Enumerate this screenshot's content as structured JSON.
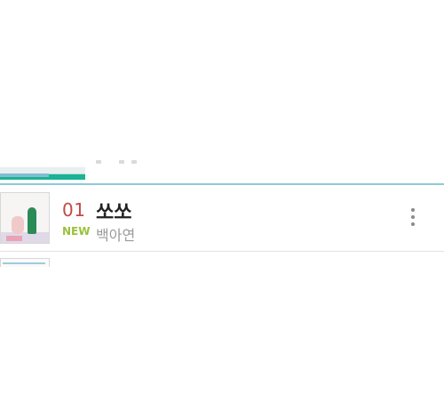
{
  "list": {
    "current_item": {
      "rank": "01",
      "badge": "NEW",
      "title": "쏘쏘",
      "artist": "백아연",
      "more_icon": "more-vertical-icon"
    }
  },
  "colors": {
    "rank": "#c24a45",
    "badge": "#9ac13b",
    "title": "#222222",
    "artist": "#9a9a9a",
    "divider_accent": "#8ec9d8"
  }
}
